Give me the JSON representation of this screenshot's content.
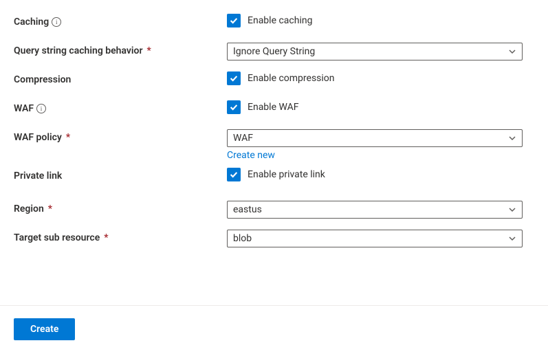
{
  "fields": {
    "caching": {
      "label": "Caching",
      "checkbox_label": "Enable caching",
      "checked": true
    },
    "query_string": {
      "label": "Query string caching behavior",
      "value": "Ignore Query String"
    },
    "compression": {
      "label": "Compression",
      "checkbox_label": "Enable compression",
      "checked": true
    },
    "waf": {
      "label": "WAF",
      "checkbox_label": "Enable WAF",
      "checked": true
    },
    "waf_policy": {
      "label": "WAF policy",
      "value": "WAF",
      "create_new": "Create new"
    },
    "private_link": {
      "label": "Private link",
      "checkbox_label": "Enable private link",
      "checked": true
    },
    "region": {
      "label": "Region",
      "value": "eastus"
    },
    "target_sub_resource": {
      "label": "Target sub resource",
      "value": "blob"
    }
  },
  "footer": {
    "create_label": "Create"
  },
  "colors": {
    "primary": "#0078d4",
    "required": "#a4262c"
  }
}
